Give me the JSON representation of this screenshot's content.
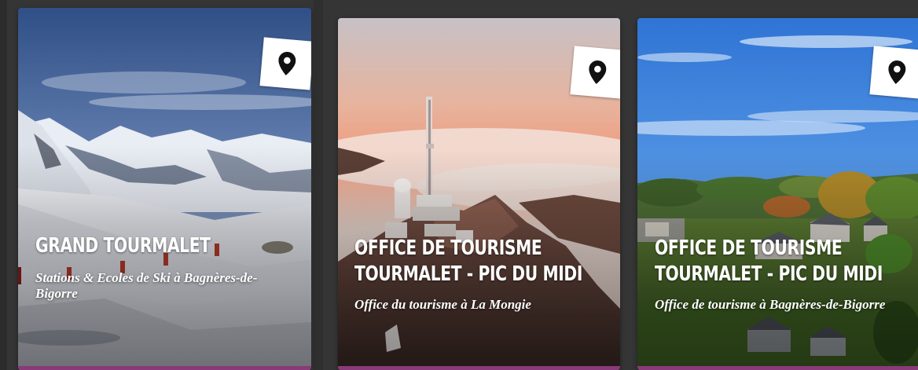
{
  "cards": [
    {
      "title": "GRAND TOURMALET",
      "subtitle": "Stations & Ecoles de Ski à Bagnères-de-Bigorre",
      "icon": "map-pin-icon",
      "accent_color": "#8a3a78"
    },
    {
      "title_line1": "OFFICE DE TOURISME",
      "title_line2": "TOURMALET - PIC DU MIDI",
      "subtitle": "Office du tourisme à La Mongie",
      "icon": "map-pin-icon",
      "accent_color": "#8a3a78"
    },
    {
      "title_line1": "OFFICE DE TOURISME",
      "title_line2": "TOURMALET - PIC DU MIDI",
      "subtitle": "Office de tourisme à Bagnères-de-Bigorre",
      "icon": "map-pin-icon",
      "accent_color": "#8a3a78"
    }
  ]
}
